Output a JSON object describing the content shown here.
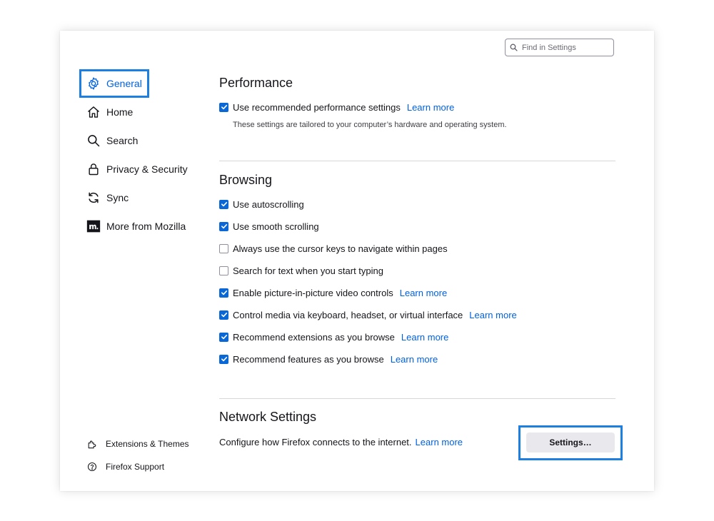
{
  "search": {
    "placeholder": "Find in Settings"
  },
  "sidebar": {
    "items": [
      {
        "label": "General",
        "icon": "gear-icon",
        "selected": true
      },
      {
        "label": "Home",
        "icon": "home-icon"
      },
      {
        "label": "Search",
        "icon": "search-icon"
      },
      {
        "label": "Privacy & Security",
        "icon": "lock-icon"
      },
      {
        "label": "Sync",
        "icon": "sync-icon"
      },
      {
        "label": "More from Mozilla",
        "icon": "mozilla-logo-icon"
      }
    ],
    "footer": [
      {
        "label": "Extensions & Themes",
        "icon": "puzzle-piece-icon"
      },
      {
        "label": "Firefox Support",
        "icon": "help-icon"
      }
    ]
  },
  "performance": {
    "title": "Performance",
    "recommended": {
      "label": "Use recommended performance settings",
      "checked": true,
      "learn_more": "Learn more"
    },
    "description": "These settings are tailored to your computer’s hardware and operating system."
  },
  "browsing": {
    "title": "Browsing",
    "options": [
      {
        "label": "Use autoscrolling",
        "checked": true
      },
      {
        "label": "Use smooth scrolling",
        "checked": true
      },
      {
        "label": "Always use the cursor keys to navigate within pages",
        "checked": false
      },
      {
        "label": "Search for text when you start typing",
        "checked": false
      },
      {
        "label": "Enable picture-in-picture video controls",
        "checked": true,
        "learn_more": "Learn more"
      },
      {
        "label": "Control media via keyboard, headset, or virtual interface",
        "checked": true,
        "learn_more": "Learn more"
      },
      {
        "label": "Recommend extensions as you browse",
        "checked": true,
        "learn_more": "Learn more"
      },
      {
        "label": "Recommend features as you browse",
        "checked": true,
        "learn_more": "Learn more"
      }
    ]
  },
  "network": {
    "title": "Network Settings",
    "description": "Configure how Firefox connects to the internet.",
    "learn_more": "Learn more",
    "button_label": "Settings…"
  },
  "colors": {
    "accent": "#0061e0",
    "checkbox": "#0a67d6",
    "highlight_outline": "#1d7fe0"
  }
}
